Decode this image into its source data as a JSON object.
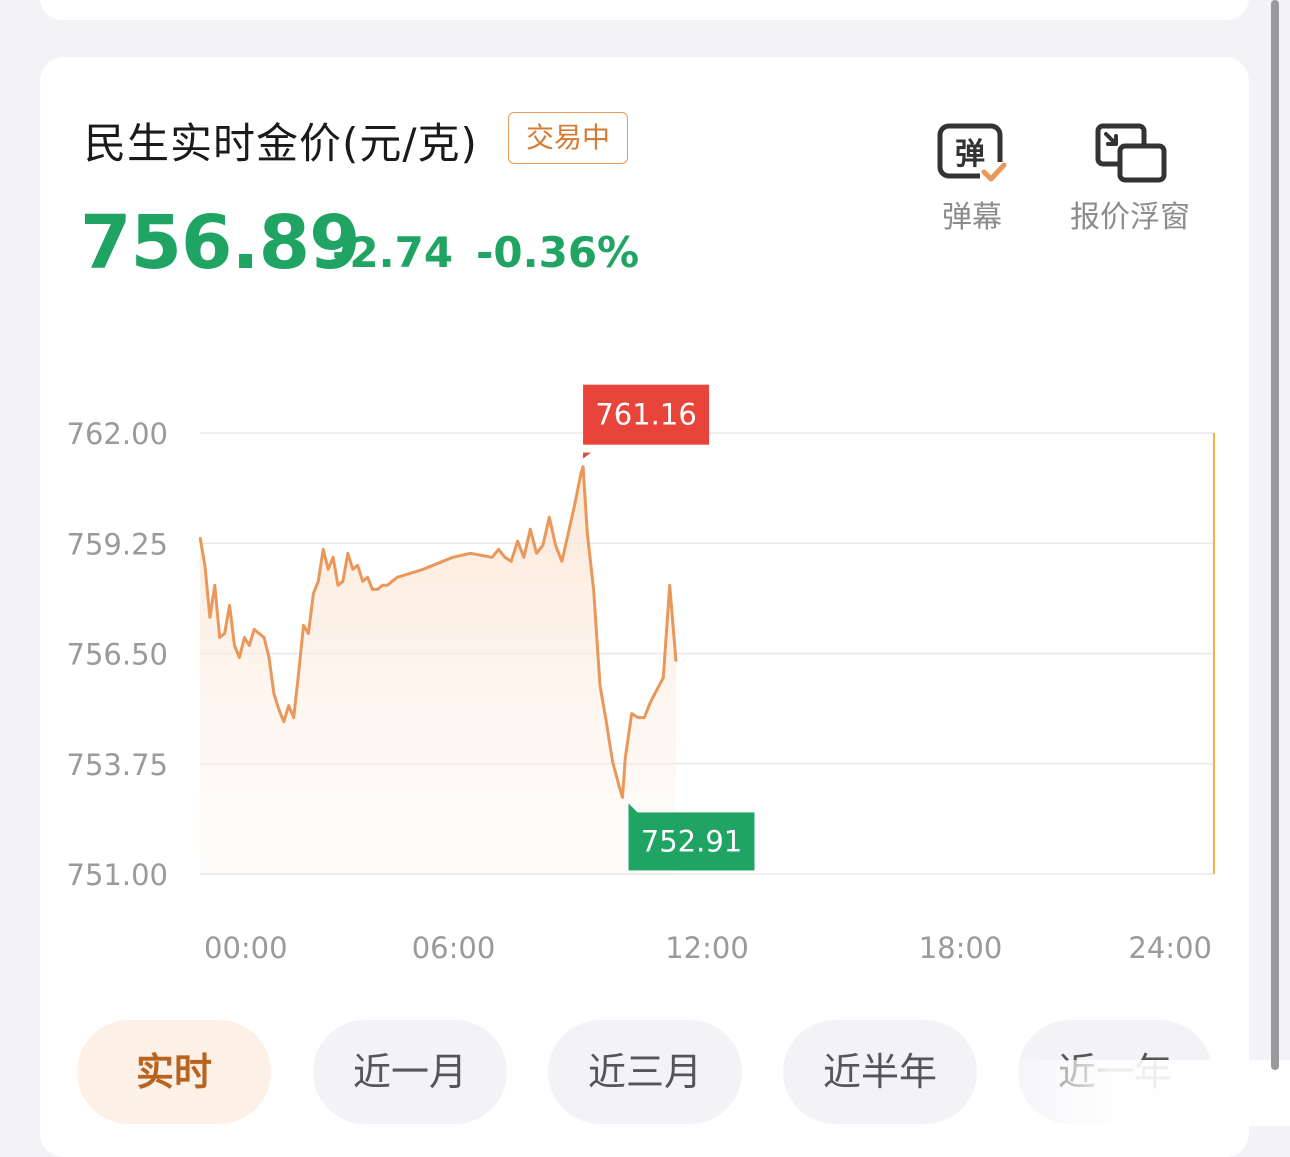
{
  "header": {
    "title": "民生实时金价(元/克)",
    "status_badge": "交易中",
    "price": "756.89",
    "change": "-2.74",
    "change_pct": "-0.36%"
  },
  "tools": [
    {
      "label": "弹幕",
      "icon": "danmaku-icon",
      "icon_text": "弹"
    },
    {
      "label": "报价浮窗",
      "icon": "float-window-icon"
    }
  ],
  "colors": {
    "up": "#e8443a",
    "down": "#1fa463",
    "line": "#e9975a",
    "accent": "#d77a32"
  },
  "chart_data": {
    "type": "line",
    "title": "",
    "xlabel": "",
    "ylabel": "",
    "x_ticks": [
      "00:00",
      "06:00",
      "12:00",
      "18:00",
      "24:00"
    ],
    "y_ticks": [
      "762.00",
      "759.25",
      "756.50",
      "753.75",
      "751.00"
    ],
    "ylim": [
      751.0,
      762.0
    ],
    "xlim_hours": [
      0,
      24
    ],
    "grid": true,
    "max_label": "761.16",
    "min_label": "752.91",
    "max": {
      "time": "09:04",
      "value": 761.16
    },
    "min": {
      "time": "10:00",
      "value": 752.91
    },
    "series": [
      {
        "x": [
          "00:00",
          "00:07",
          "00:14",
          "00:21",
          "00:28",
          "00:35",
          "00:42",
          "00:49",
          "00:56",
          "01:03",
          "01:10",
          "01:17",
          "01:24",
          "01:31",
          "01:38",
          "01:45",
          "01:52",
          "01:59",
          "02:06",
          "02:13",
          "02:20",
          "02:27",
          "02:34",
          "02:41",
          "02:48",
          "02:55",
          "03:02",
          "03:09",
          "03:16",
          "03:23",
          "03:30",
          "03:37",
          "03:44",
          "03:51",
          "03:58",
          "04:05",
          "04:12",
          "04:19",
          "04:26",
          "04:33",
          "04:40",
          "05:17",
          "05:59",
          "06:24",
          "06:55",
          "07:04",
          "07:13",
          "07:22",
          "07:31",
          "07:40",
          "07:49",
          "07:58",
          "08:07",
          "08:16",
          "08:25",
          "08:34",
          "08:43",
          "08:52",
          "09:01",
          "09:04",
          "09:10",
          "09:19",
          "09:28",
          "09:37",
          "09:46",
          "09:55",
          "10:00",
          "10:04",
          "10:13",
          "10:22",
          "10:31",
          "10:40",
          "10:49",
          "10:58",
          "11:07",
          "11:16"
        ],
        "values": [
          759.4,
          758.7,
          757.4,
          758.2,
          756.9,
          757.0,
          757.7,
          756.7,
          756.4,
          756.9,
          756.7,
          757.1,
          757.0,
          756.9,
          756.4,
          755.5,
          755.1,
          754.8,
          755.2,
          754.9,
          756.0,
          757.2,
          757.0,
          758.0,
          758.3,
          759.1,
          758.6,
          758.9,
          758.2,
          758.3,
          759.0,
          758.6,
          758.7,
          758.3,
          758.4,
          758.1,
          758.1,
          758.2,
          758.2,
          758.3,
          758.4,
          758.6,
          758.9,
          759.0,
          758.9,
          759.1,
          758.9,
          758.8,
          759.3,
          758.9,
          759.6,
          759.0,
          759.2,
          759.9,
          759.2,
          758.8,
          759.5,
          760.2,
          761.0,
          761.16,
          759.5,
          758.1,
          755.7,
          754.8,
          753.8,
          753.2,
          752.91,
          753.9,
          755.0,
          754.9,
          754.9,
          755.3,
          755.6,
          755.9,
          758.2,
          756.3
        ]
      }
    ]
  },
  "tabs": [
    {
      "label": "实时",
      "active": true
    },
    {
      "label": "近一月",
      "active": false
    },
    {
      "label": "近三月",
      "active": false
    },
    {
      "label": "近半年",
      "active": false
    },
    {
      "label": "近一年",
      "active": false
    }
  ]
}
